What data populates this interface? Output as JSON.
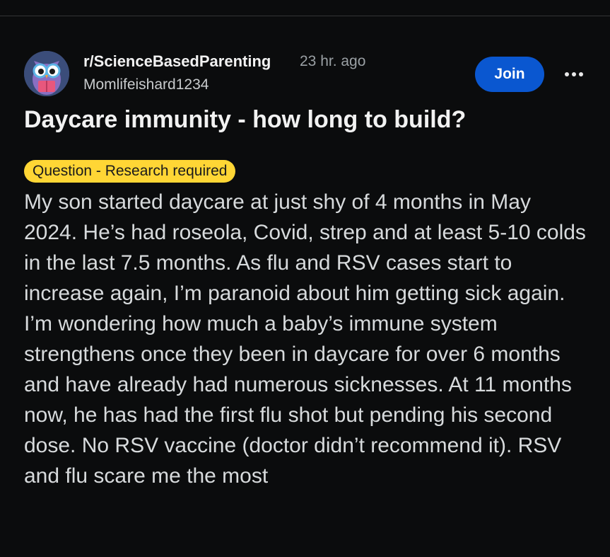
{
  "post": {
    "subreddit": "r/ScienceBasedParenting",
    "time_ago": "23 hr. ago",
    "author": "Momlifeishard1234",
    "join_label": "Join",
    "more_icon": "more-options-icon",
    "title": "Daycare immunity - how long to build?",
    "flair": "Question - Research required",
    "body": "My son started daycare at just shy of 4 months in May 2024. He’s had roseola, Covid, strep and at least 5-10 colds in the last 7.5 months. As flu and RSV cases start to increase again, I’m paranoid about him getting sick again. I’m wondering how much a baby’s immune system strengthens once they been in daycare for over 6 months and have already had numerous sicknesses. At 11 months now, he has had the first flu shot but pending his second dose. No RSV vaccine (doctor didn’t recommend it). RSV and flu scare me the most"
  },
  "colors": {
    "background": "#0b0c0d",
    "join_button": "#0a57d0",
    "flair_background": "#ffd635"
  }
}
